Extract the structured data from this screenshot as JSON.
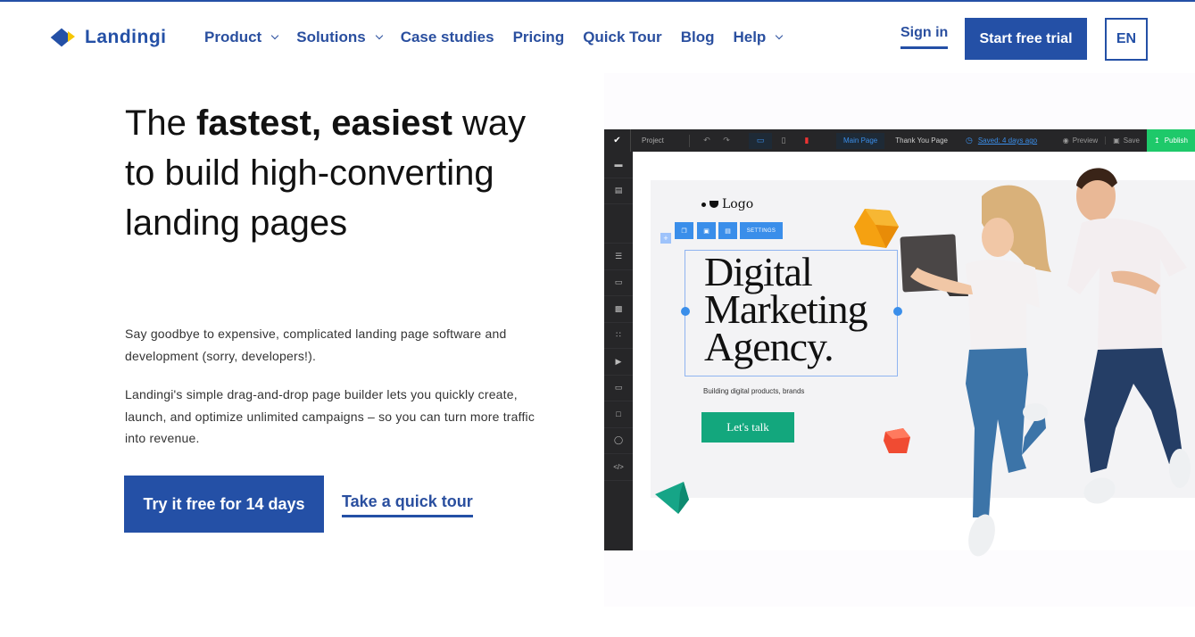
{
  "header": {
    "brand": "Landingi",
    "nav": [
      {
        "label": "Product",
        "has_dropdown": true
      },
      {
        "label": "Solutions",
        "has_dropdown": true
      },
      {
        "label": "Case studies",
        "has_dropdown": false
      },
      {
        "label": "Pricing",
        "has_dropdown": false
      },
      {
        "label": "Quick Tour",
        "has_dropdown": false
      },
      {
        "label": "Blog",
        "has_dropdown": false
      },
      {
        "label": "Help",
        "has_dropdown": true
      }
    ],
    "sign_in": "Sign in",
    "start_trial": "Start free trial",
    "language": "EN"
  },
  "hero": {
    "title_prefix": "The ",
    "title_bold": "fastest, easiest",
    "title_rest": " way to build high-converting landing pages",
    "paragraph_1": "Say goodbye to expensive, complicated landing page software and development (sorry, developers!).",
    "paragraph_2": "Landingi's simple drag-and-drop page builder lets you quickly create, launch, and optimize unlimited campaigns – so you can turn more traffic into revenue.",
    "cta_primary": "Try it free for 14 days",
    "cta_secondary": "Take a quick tour"
  },
  "mockup": {
    "toolbar": {
      "project": "Project",
      "pages": [
        "Main Page",
        "Thank You Page"
      ],
      "active_page": "Main Page",
      "saved": "Saved: 4 days ago",
      "preview": "Preview",
      "save": "Save",
      "publish": "Publish"
    },
    "sidebar_icons": [
      "section-icon",
      "row-icon",
      "text-icon",
      "button-icon",
      "image-icon",
      "shapes-icon",
      "video-icon",
      "form-icon",
      "box-icon",
      "timer-icon",
      "code-icon"
    ],
    "canvas": {
      "logo": "Logo",
      "settings": "SETTINGS",
      "headline": [
        "Digital",
        "Marketing",
        "Agency."
      ],
      "subtext": "Building digital products, brands",
      "cta": "Let's talk"
    }
  },
  "colors": {
    "brand_blue": "#2450a6",
    "brand_yellow": "#f6c600",
    "editor_dark": "#262628",
    "editor_accent": "#3a8eea",
    "publish_green": "#1ec96a",
    "mock_cta_green": "#13a77d"
  }
}
